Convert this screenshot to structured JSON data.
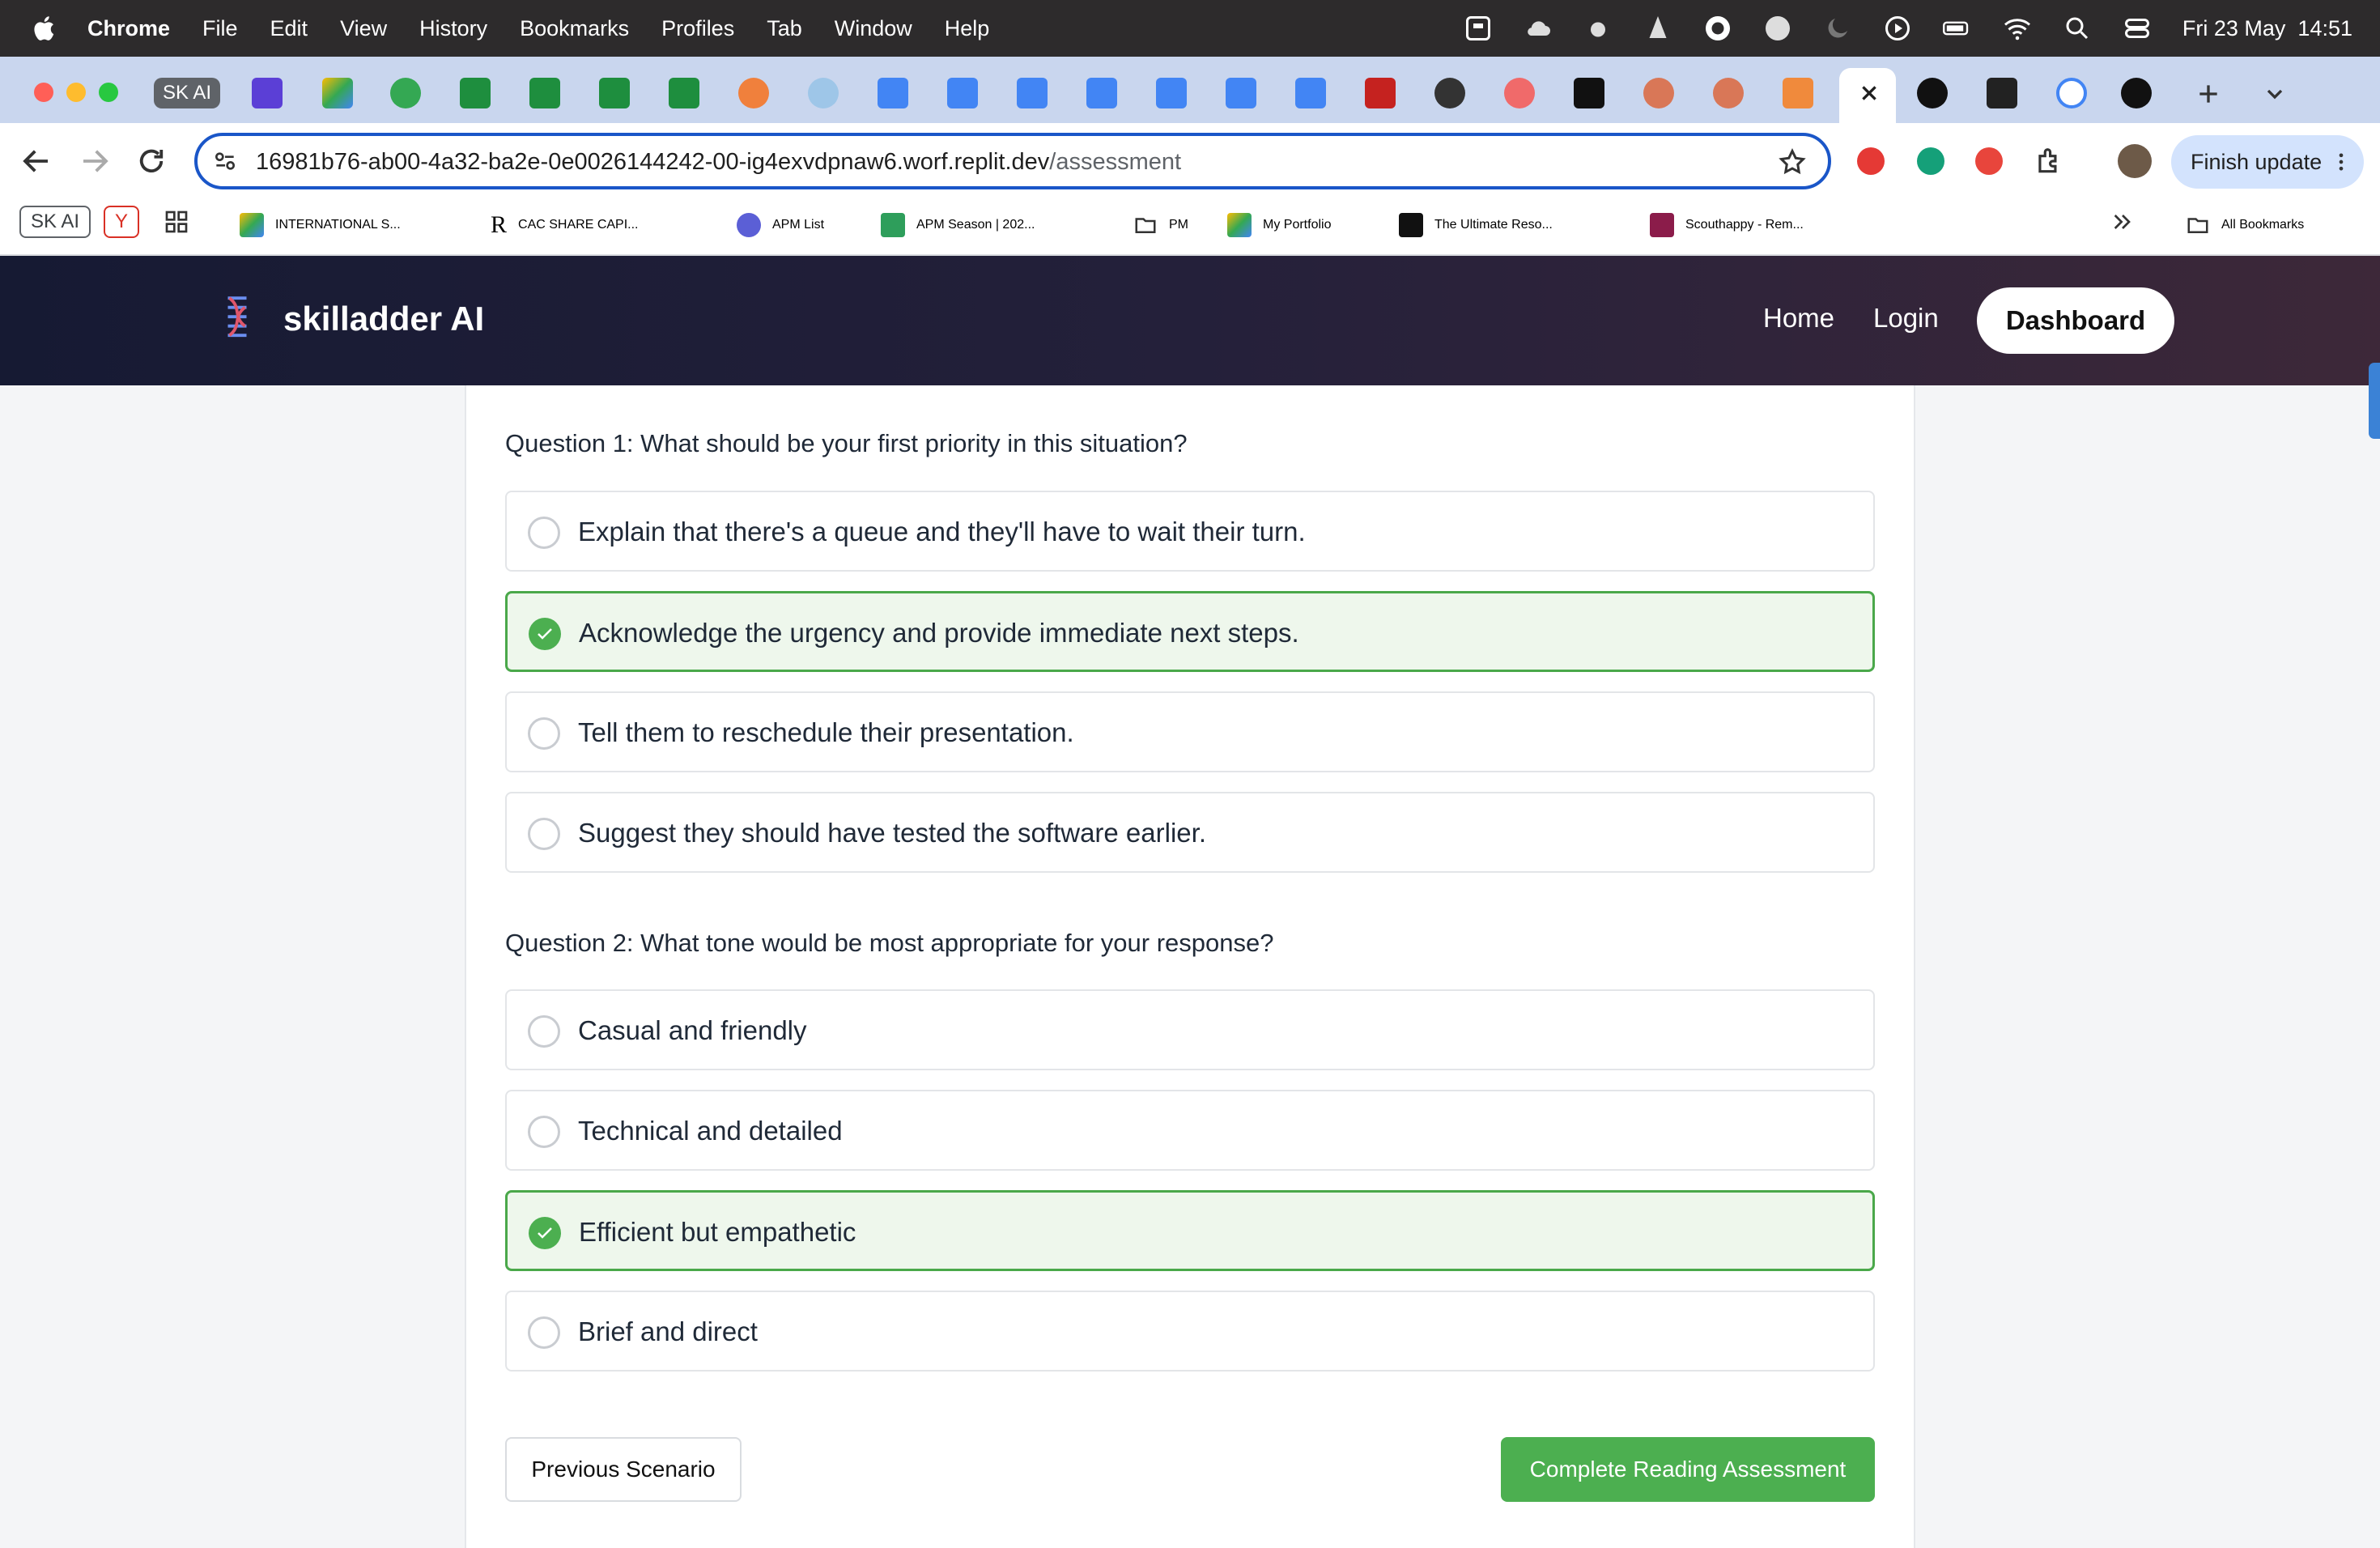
{
  "menubar": {
    "app": "Chrome",
    "items": [
      "File",
      "Edit",
      "View",
      "History",
      "Bookmarks",
      "Profiles",
      "Tab",
      "Window",
      "Help"
    ],
    "datetime": "Fri 23 May  14:51"
  },
  "tabs": {
    "first_tab_label": "SK AI"
  },
  "toolbar": {
    "url_host": "16981b76-ab00-4a32-ba2e-0e0026144242-00-ig4exvdpnaw6.worf.replit.dev",
    "url_path": "/assessment",
    "finish_update": "Finish update"
  },
  "bookmarks": {
    "items": [
      "SK AI",
      "Y",
      "INTERNATIONAL S...",
      "CAC SHARE CAPI...",
      "APM List",
      "APM Season | 202...",
      "PM",
      "My Portfolio",
      "The Ultimate Reso...",
      "Scouthappy - Rem..."
    ],
    "all_bookmarks": "All Bookmarks"
  },
  "header": {
    "brand": "skilladder AI",
    "nav": [
      "Home",
      "Login"
    ],
    "dashboard": "Dashboard"
  },
  "questions": [
    {
      "text": "Question 1: What should be your first priority in this situation?",
      "options": [
        "Explain that there's a queue and they'll have to wait their turn.",
        "Acknowledge the urgency and provide immediate next steps.",
        "Tell them to reschedule their presentation.",
        "Suggest they should have tested the software earlier."
      ],
      "selected_index": 1
    },
    {
      "text": "Question 2: What tone would be most appropriate for your response?",
      "options": [
        "Casual and friendly",
        "Technical and detailed",
        "Efficient but empathetic",
        "Brief and direct"
      ],
      "selected_index": 2
    }
  ],
  "buttons": {
    "previous": "Previous Scenario",
    "complete": "Complete Reading Assessment"
  },
  "colors": {
    "accent_green": "#4caf50",
    "selected_bg": "#eef7ec",
    "header_dark": "#161a33"
  }
}
